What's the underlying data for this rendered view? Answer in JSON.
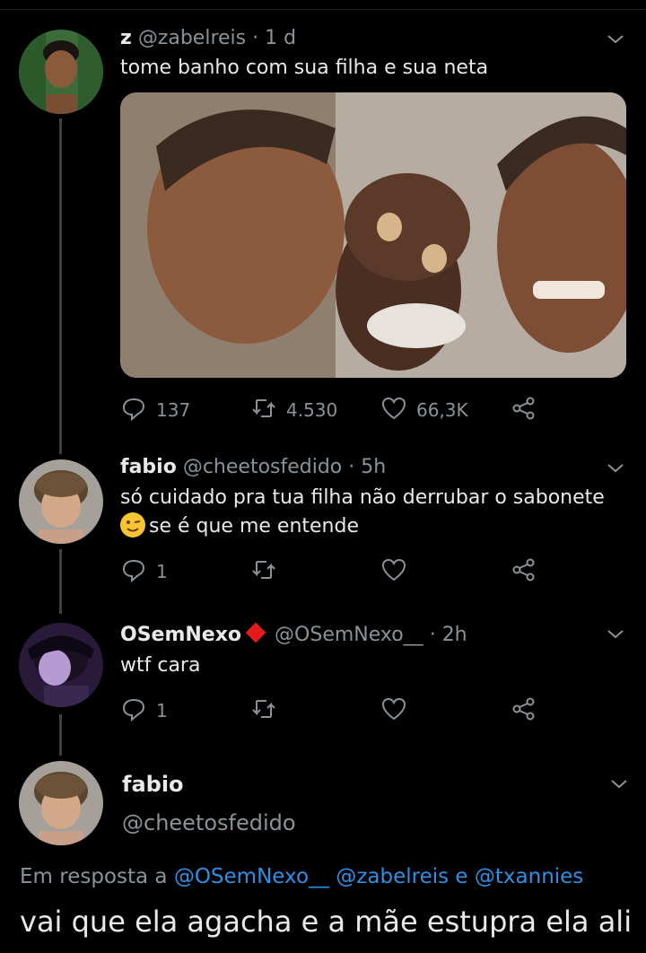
{
  "tweets": [
    {
      "name": "z",
      "handle": "@zabelreis",
      "sep": "·",
      "time": "1 d",
      "text": "tome banho com sua filha e sua neta",
      "has_media": true,
      "actions": {
        "replies": "137",
        "retweets": "4.530",
        "likes": "66,3K"
      }
    },
    {
      "name": "fabio",
      "handle": "@cheetosfedido",
      "sep": "·",
      "time": "5h",
      "text_line1": "só cuidado pra tua filha não derrubar o sabonete",
      "text_line2": "se é que me entende",
      "actions": {
        "replies": "1",
        "retweets": "",
        "likes": ""
      }
    },
    {
      "name": "OSemNexo",
      "handle": "@OSemNexo__",
      "sep": "·",
      "time": "2h",
      "text": "wtf cara",
      "actions": {
        "replies": "1",
        "retweets": "",
        "likes": ""
      }
    }
  ],
  "main_tweet": {
    "name": "fabio",
    "handle": "@cheetosfedido",
    "reply_prefix": "Em resposta a",
    "reply_to": [
      "@OSemNexo__",
      "@zabelreis",
      "@txannies"
    ],
    "reply_joiner": "e",
    "text": "vai que ela agacha e a mãe estupra ela ali"
  },
  "colors": {
    "background": "#000000",
    "text": "#e7e9ea",
    "muted": "#8b9298",
    "link": "#2f8fe4",
    "verified_diamond": "#e21b1b"
  },
  "icons": [
    "reply-icon",
    "retweet-icon",
    "like-icon",
    "share-icon",
    "chevron-down-icon",
    "wink-emoji-icon",
    "red-diamond-icon"
  ]
}
